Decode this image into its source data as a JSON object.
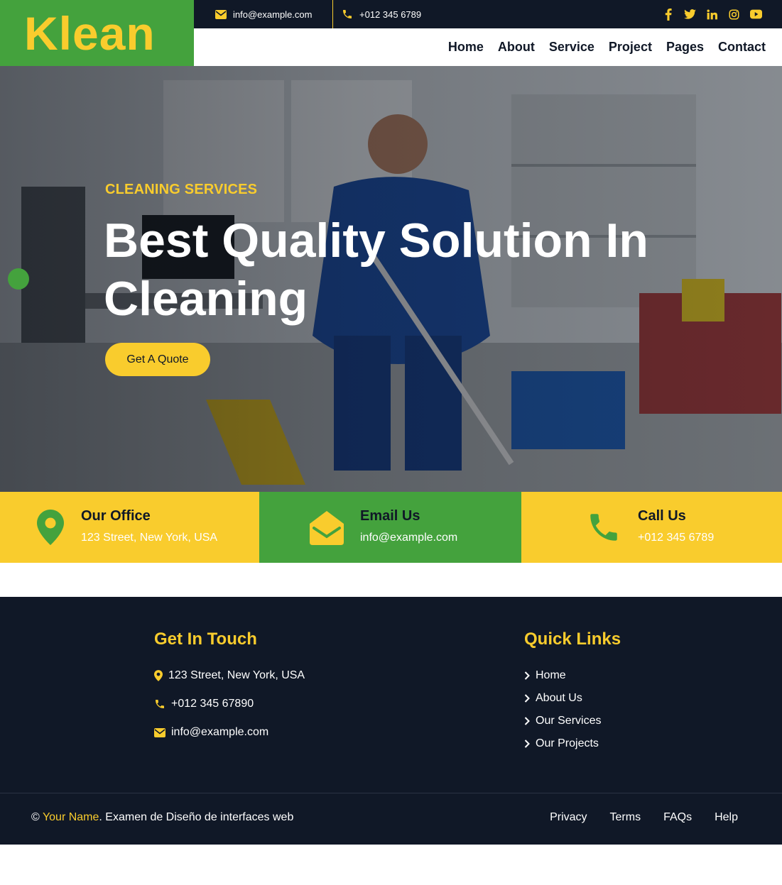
{
  "brand": {
    "name": "Klean"
  },
  "topbar": {
    "email": "info@example.com",
    "phone": "+012 345 6789",
    "social": [
      "facebook-icon",
      "twitter-icon",
      "linkedin-icon",
      "instagram-icon",
      "youtube-icon"
    ]
  },
  "nav": {
    "items": [
      "Home",
      "About",
      "Service",
      "Project",
      "Pages",
      "Contact"
    ]
  },
  "hero": {
    "kicker": "CLEANING SERVICES",
    "title": "Best Quality Solution In Cleaning",
    "button": "Get A Quote"
  },
  "contact_strip": [
    {
      "icon": "map-marker-icon",
      "title": "Our Office",
      "value": "123 Street, New York, USA"
    },
    {
      "icon": "envelope-open-icon",
      "title": "Email Us",
      "value": "info@example.com"
    },
    {
      "icon": "phone-icon",
      "title": "Call Us",
      "value": "+012 345 6789"
    }
  ],
  "footer": {
    "get_in_touch": {
      "heading": "Get In Touch",
      "address": "123 Street, New York, USA",
      "phone": "+012 345 67890",
      "email": "info@example.com"
    },
    "quick_links": {
      "heading": "Quick Links",
      "items": [
        "Home",
        "About Us",
        "Our Services",
        "Our Projects"
      ]
    },
    "copyright": {
      "symbol": "©",
      "owner": "Your Name",
      "text": ". Examen de Diseño de interfaces web"
    },
    "legal_links": [
      "Privacy",
      "Terms",
      "FAQs",
      "Help"
    ]
  },
  "colors": {
    "green": "#44a23d",
    "yellow": "#f9cc2d",
    "dark": "#101827",
    "white": "#ffffff"
  }
}
